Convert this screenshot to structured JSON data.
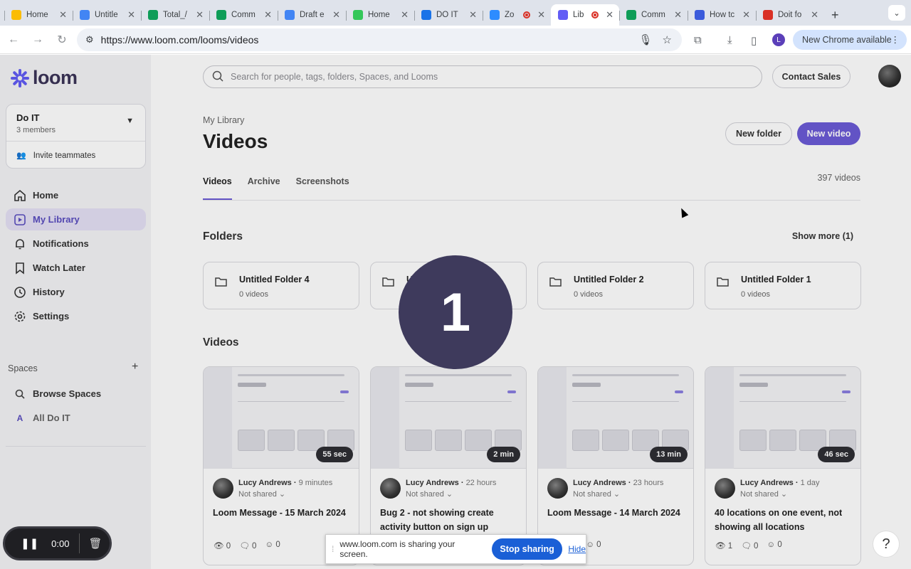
{
  "browser": {
    "tabs": [
      {
        "label": "Home",
        "icon": "google-drive-icon",
        "color": "#fbbc04",
        "active": false,
        "recording": false
      },
      {
        "label": "Untitle",
        "icon": "google-docs-icon",
        "color": "#4285f4",
        "active": false,
        "recording": false
      },
      {
        "label": "Total_/",
        "icon": "google-sheets-icon",
        "color": "#0f9d58",
        "active": false,
        "recording": false
      },
      {
        "label": "Comm",
        "icon": "google-sheets-icon",
        "color": "#0f9d58",
        "active": false,
        "recording": false
      },
      {
        "label": "Draft e",
        "icon": "google-docs-icon",
        "color": "#4285f4",
        "active": false,
        "recording": false
      },
      {
        "label": "Home",
        "icon": "green-square-icon",
        "color": "#34c759",
        "active": false,
        "recording": false
      },
      {
        "label": "DO IT",
        "icon": "calendar-icon",
        "color": "#1a73e8",
        "active": false,
        "recording": false
      },
      {
        "label": "Zo",
        "icon": "zoom-icon",
        "color": "#2d8cff",
        "active": false,
        "recording": true
      },
      {
        "label": "Lib",
        "icon": "loom-icon",
        "color": "#625df5",
        "active": true,
        "recording": true
      },
      {
        "label": "Comm",
        "icon": "google-sheets-icon",
        "color": "#0f9d58",
        "active": false,
        "recording": false
      },
      {
        "label": "How tc",
        "icon": "monday-icon",
        "color": "#3b5bdb",
        "active": false,
        "recording": false
      },
      {
        "label": "Doit fo",
        "icon": "gmail-icon",
        "color": "#d93025",
        "active": false,
        "recording": false
      }
    ],
    "url": "https://www.loom.com/looms/videos",
    "profile_initial": "L",
    "new_chrome_label": "New Chrome available"
  },
  "sidebar": {
    "brand": "loom",
    "workspace": {
      "name": "Do IT",
      "members": "3 members",
      "invite": "Invite teammates"
    },
    "nav": [
      {
        "label": "Home",
        "icon": "home-icon",
        "active": false
      },
      {
        "label": "My Library",
        "icon": "library-icon",
        "active": true
      },
      {
        "label": "Notifications",
        "icon": "bell-icon",
        "active": false
      },
      {
        "label": "Watch Later",
        "icon": "bookmark-icon",
        "active": false
      },
      {
        "label": "History",
        "icon": "clock-icon",
        "active": false
      },
      {
        "label": "Settings",
        "icon": "gear-icon",
        "active": false
      }
    ],
    "spaces_header": "Spaces",
    "spaces": [
      {
        "label": "Browse Spaces",
        "icon": "search-icon"
      },
      {
        "label": "All Do IT",
        "icon": "A"
      }
    ]
  },
  "main": {
    "search_placeholder": "Search for people, tags, folders, Spaces, and Looms",
    "contact_sales": "Contact Sales",
    "breadcrumb": "My Library",
    "title": "Videos",
    "new_folder": "New folder",
    "new_video": "New video",
    "tabs": [
      "Videos",
      "Archive",
      "Screenshots"
    ],
    "video_count": "397 videos",
    "folders_header": "Folders",
    "show_more": "Show more (1)",
    "folders": [
      {
        "name": "Untitled Folder 4",
        "count": "0 videos"
      },
      {
        "name": "U",
        "count": "0 videos"
      },
      {
        "name": "Untitled Folder 2",
        "count": "0 videos"
      },
      {
        "name": "Untitled Folder 1",
        "count": "0 videos"
      }
    ],
    "videos_header": "Videos",
    "videos": [
      {
        "duration": "55 sec",
        "author": "Lucy Andrews",
        "ago": "9 minutes",
        "shared": "Not shared",
        "title": "Loom Message - 15 March 2024",
        "views": "0",
        "comments": "0",
        "reactions": "0"
      },
      {
        "duration": "2 min",
        "author": "Lucy Andrews",
        "ago": "22 hours",
        "shared": "Not shared",
        "title": "Bug 2 - not showing create activity button on sign up",
        "views": "",
        "comments": "",
        "reactions": ""
      },
      {
        "duration": "13 min",
        "author": "Lucy Andrews",
        "ago": "23 hours",
        "shared": "Not shared",
        "title": "Loom Message - 14 March 2024",
        "views": "",
        "comments": "",
        "reactions": "0"
      },
      {
        "duration": "46 sec",
        "author": "Lucy Andrews",
        "ago": "1 day",
        "shared": "Not shared",
        "title": "40 locations on one event, not showing all locations",
        "views": "1",
        "comments": "0",
        "reactions": "0"
      }
    ]
  },
  "overlays": {
    "countdown": "1",
    "recorder_time": "0:00",
    "share_message": "www.loom.com is sharing your screen.",
    "stop_sharing": "Stop sharing",
    "hide": "Hide",
    "help": "?"
  }
}
